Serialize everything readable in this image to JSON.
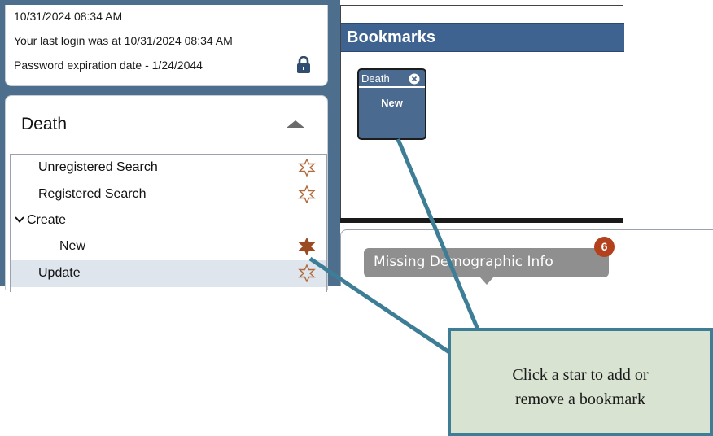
{
  "session": {
    "datetime": "10/31/2024 08:34 AM",
    "last_login": "Your last login was at 10/31/2024 08:34 AM",
    "password_expiration": "Password expiration date - 1/24/2044",
    "lock_icon": "lock-icon"
  },
  "death_panel": {
    "title": "Death",
    "collapse_icon": "caret-up-icon",
    "items": [
      {
        "label": "Unregistered Search",
        "starred": false
      },
      {
        "label": "Registered Search",
        "starred": false
      },
      {
        "label": "Create",
        "expanded": true
      },
      {
        "label": "New",
        "starred": true
      },
      {
        "label": "Update",
        "starred": false,
        "selected": true
      }
    ]
  },
  "bookmarks": {
    "title": "Bookmarks",
    "tiles": [
      {
        "name": "Death",
        "action": "New",
        "close_icon": "close-icon"
      }
    ]
  },
  "demographics": {
    "label": "Missing Demographic Info",
    "count": "6"
  },
  "callout": {
    "line1": "Click a star to add or",
    "line2": "remove a bookmark"
  },
  "colors": {
    "panel_blue": "#4e6e8e",
    "header_blue": "#3e6390",
    "star_filled": "#9b4a22",
    "star_outline": "#b06a3c",
    "badge": "#b3411e",
    "callout_border": "#3d7e96",
    "callout_fill": "#d9e3d2"
  }
}
